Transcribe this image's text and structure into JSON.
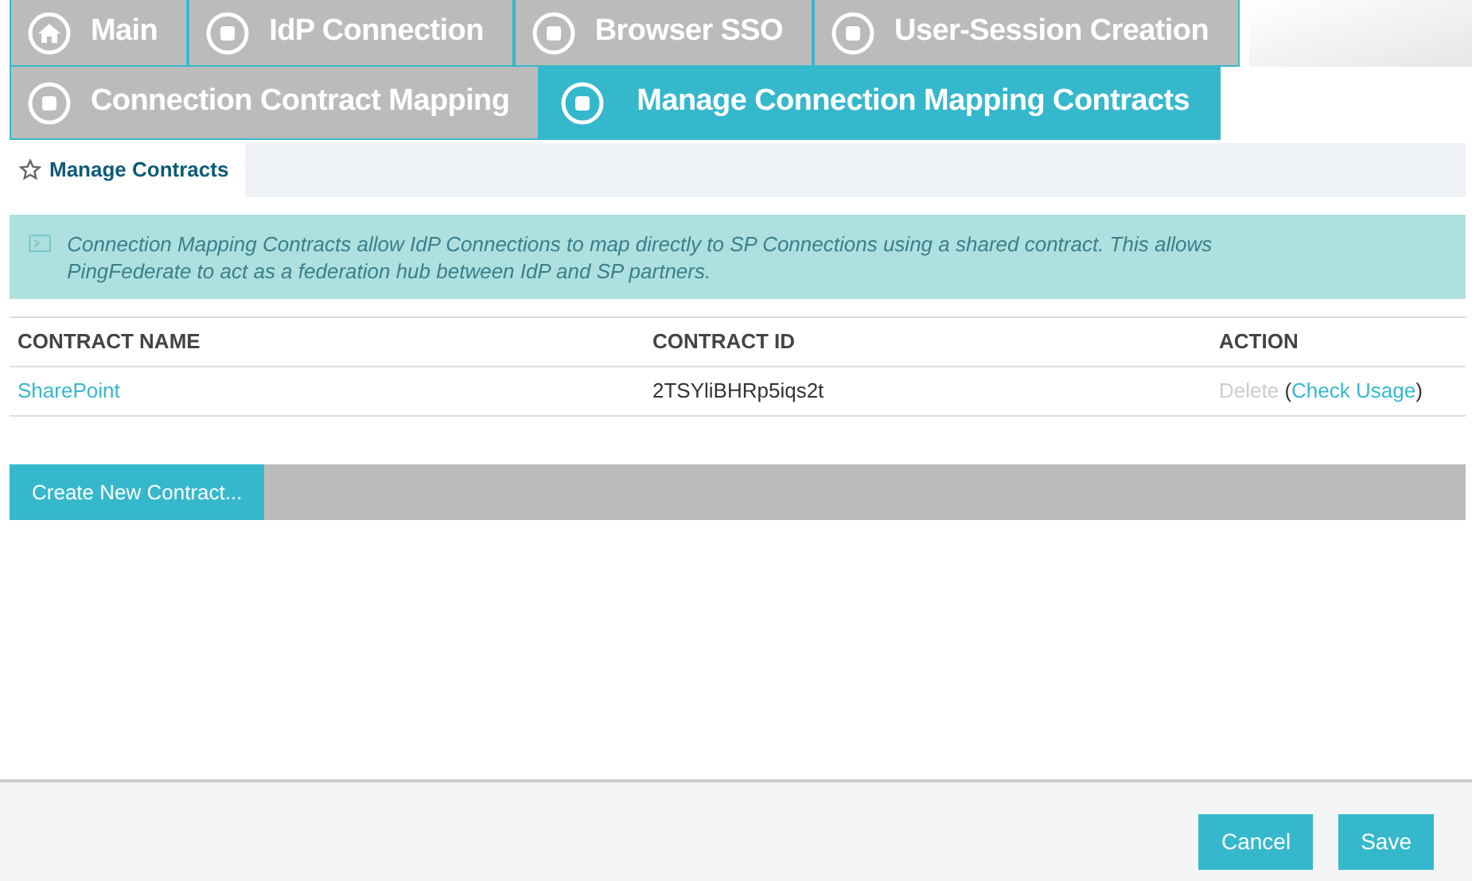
{
  "tabs": [
    [
      {
        "label": "Main",
        "kind": "home",
        "selected": false
      },
      {
        "label": "IdP Connection",
        "kind": "step",
        "selected": false
      },
      {
        "label": "Browser SSO",
        "kind": "step",
        "selected": false
      },
      {
        "label": "User-Session Creation",
        "kind": "step",
        "selected": false
      }
    ],
    [
      {
        "label": "Connection Contract Mapping",
        "kind": "step",
        "selected": false
      },
      {
        "label": "Manage Connection Mapping Contracts",
        "kind": "step",
        "selected": true
      }
    ]
  ],
  "subtabs": [
    {
      "label": "Manage Contracts",
      "selected": true
    }
  ],
  "info": "Connection Mapping Contracts allow IdP Connections to map directly to SP Connections using a shared contract. This allows PingFederate to act as a federation hub between IdP and SP partners.",
  "table": {
    "columns": [
      "CONTRACT NAME",
      "CONTRACT ID",
      "ACTION"
    ],
    "rows": [
      {
        "name": "SharePoint",
        "id": "2TSYliBHRp5iqs2t",
        "actions": [
          {
            "label": "Delete",
            "disabled": true
          },
          {
            "label": "Check Usage",
            "disabled": false
          }
        ],
        "paren_open": "(",
        "paren_close": ")"
      }
    ]
  },
  "create_button": "Create New Contract...",
  "buttons": [
    "Cancel",
    "Save"
  ]
}
